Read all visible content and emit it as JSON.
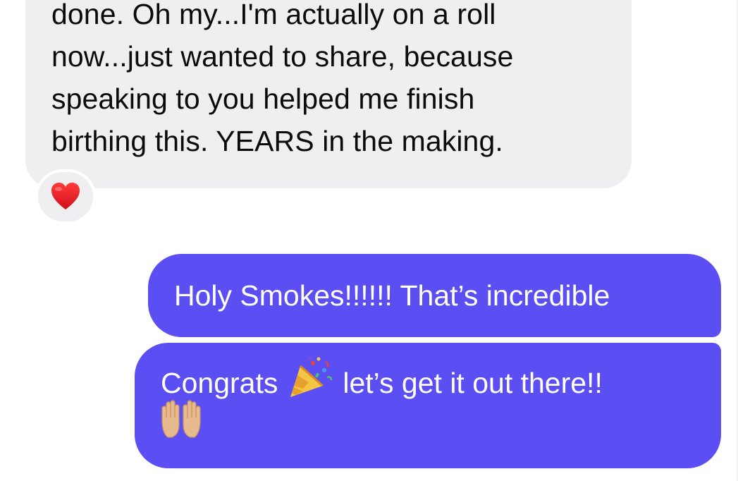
{
  "messages": {
    "incoming": {
      "lines": [
        "done. Oh my...I'm actually on a roll",
        "now...just wanted to share, because",
        "speaking to you helped me finish",
        "birthing this. YEARS in the making."
      ],
      "reaction": "heart-icon"
    },
    "outgoing": [
      {
        "text": "Holy Smokes!!!!!! That’s incredible"
      },
      {
        "text_before_emoji": "Congrats",
        "emoji_1": "party-popper-icon",
        "text_after_emoji": "let’s get it out there!!",
        "emoji_2": "raising-hands-icon"
      }
    ]
  },
  "colors": {
    "incoming_bubble": "#efeff1",
    "outgoing_bubble": "#5b4ef2",
    "incoming_text": "#0b0b0b",
    "outgoing_text": "#ffffff",
    "reaction_heart": "#e0151c"
  }
}
